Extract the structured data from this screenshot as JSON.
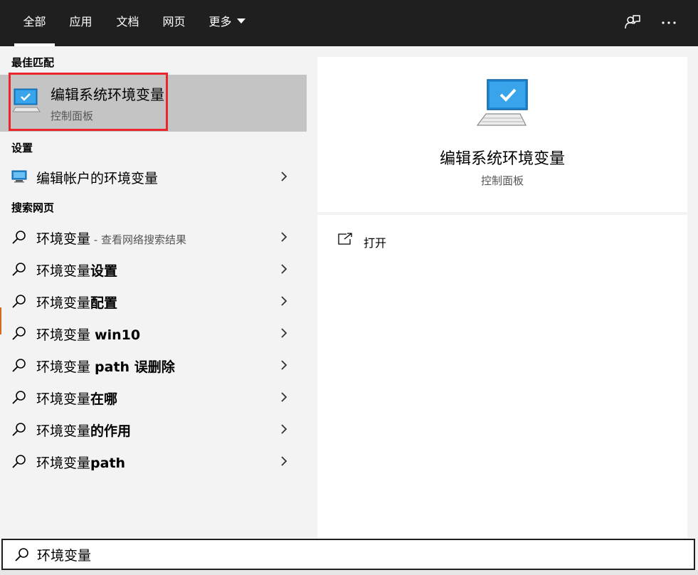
{
  "tabs": [
    {
      "label": "全部",
      "active": true
    },
    {
      "label": "应用",
      "active": false
    },
    {
      "label": "文档",
      "active": false
    },
    {
      "label": "网页",
      "active": false
    },
    {
      "label": "更多",
      "active": false
    }
  ],
  "topbar_icons": [
    "feedback-icon",
    "more-options-icon"
  ],
  "sections": {
    "best_match": "最佳匹配",
    "settings": "设置",
    "web": "搜索网页"
  },
  "best_match": {
    "title": "编辑系统环境变量",
    "subtitle": "控制面板",
    "icon": "monitor-check-icon",
    "highlight_color": "#e8262c"
  },
  "settings_items": [
    {
      "label": "编辑帐户的环境变量",
      "icon": "monitor-settings-icon"
    }
  ],
  "web_items": [
    {
      "query": "环境变量",
      "suffix": " - 查看网络搜索结果"
    },
    {
      "query": "环境变量",
      "suffix": "设置"
    },
    {
      "query": "环境变量",
      "suffix": "配置"
    },
    {
      "query": "环境变量 ",
      "suffix": "win10"
    },
    {
      "query": "环境变量 ",
      "suffix": "path 误删除"
    },
    {
      "query": "环境变量",
      "suffix": "在哪"
    },
    {
      "query": "环境变量",
      "suffix": "的作用"
    },
    {
      "query": "环境变量",
      "suffix": "path"
    }
  ],
  "preview": {
    "title": "编辑系统环境变量",
    "subtitle": "控制面板",
    "actions": [
      {
        "label": "打开",
        "icon": "open-icon"
      }
    ]
  },
  "search": {
    "value": "环境变量",
    "icon": "search-icon"
  },
  "colors": {
    "topbar": "#1f1f1f",
    "pane": "#f3f3f3",
    "selected": "#c4c4c4",
    "accent_blue": "#1e8ad6"
  }
}
